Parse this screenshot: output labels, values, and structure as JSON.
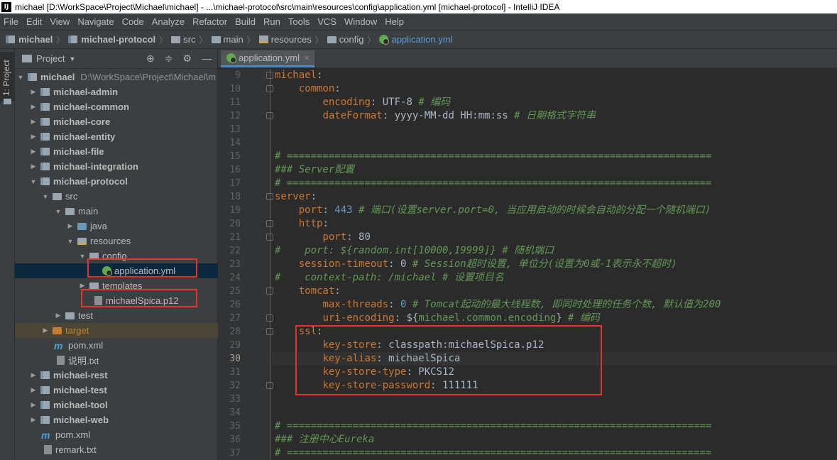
{
  "window": {
    "title": "michael [D:\\WorkSpace\\Project\\Michael\\michael] - ...\\michael-protocol\\src\\main\\resources\\config\\application.yml [michael-protocol] - IntelliJ IDEA",
    "app_icon": "IJ"
  },
  "menu": [
    "File",
    "Edit",
    "View",
    "Navigate",
    "Code",
    "Analyze",
    "Refactor",
    "Build",
    "Run",
    "Tools",
    "VCS",
    "Window",
    "Help"
  ],
  "breadcrumbs": [
    "michael",
    "michael-protocol",
    "src",
    "main",
    "resources",
    "config",
    "application.yml"
  ],
  "sidebar_tab": "1: Project",
  "project_panel": {
    "title": "Project",
    "root": {
      "name": "michael",
      "path": "D:\\WorkSpace\\Project\\Michael\\m"
    },
    "items": [
      {
        "label": "michael-admin"
      },
      {
        "label": "michael-common"
      },
      {
        "label": "michael-core"
      },
      {
        "label": "michael-entity"
      },
      {
        "label": "michael-file"
      },
      {
        "label": "michael-integration"
      },
      {
        "label": "michael-protocol"
      },
      {
        "label": "src"
      },
      {
        "label": "main"
      },
      {
        "label": "java"
      },
      {
        "label": "resources"
      },
      {
        "label": "config"
      },
      {
        "label": "application.yml"
      },
      {
        "label": "templates"
      },
      {
        "label": "michaelSpica.p12"
      },
      {
        "label": "test"
      },
      {
        "label": "target"
      },
      {
        "label": "pom.xml"
      },
      {
        "label": "说明.txt"
      },
      {
        "label": "michael-rest"
      },
      {
        "label": "michael-test"
      },
      {
        "label": "michael-tool"
      },
      {
        "label": "michael-web"
      },
      {
        "label": "pom.xml"
      },
      {
        "label": "remark.txt"
      }
    ]
  },
  "editor": {
    "tab_label": "application.yml",
    "close_glyph": "×",
    "current_line": 30,
    "lines": [
      {
        "n": "9",
        "t": [
          [
            "k",
            "michael"
          ],
          [
            "p",
            ":"
          ]
        ]
      },
      {
        "n": "10",
        "t": [
          [
            "p",
            "    "
          ],
          [
            "k",
            "common"
          ],
          [
            "p",
            ":"
          ]
        ]
      },
      {
        "n": "11",
        "t": [
          [
            "p",
            "        "
          ],
          [
            "k",
            "encoding"
          ],
          [
            "p",
            ": UTF-8 "
          ],
          [
            "c",
            "# 编码"
          ]
        ]
      },
      {
        "n": "12",
        "t": [
          [
            "p",
            "        "
          ],
          [
            "k",
            "dateFormat"
          ],
          [
            "p",
            ": yyyy-MM-dd HH:mm:ss "
          ],
          [
            "c",
            "# 日期格式字符串"
          ]
        ]
      },
      {
        "n": "13",
        "t": []
      },
      {
        "n": "14",
        "t": []
      },
      {
        "n": "15",
        "t": [
          [
            "c",
            "# ======================================================================="
          ]
        ]
      },
      {
        "n": "16",
        "t": [
          [
            "c",
            "### Server配置"
          ]
        ]
      },
      {
        "n": "17",
        "t": [
          [
            "c",
            "# ======================================================================="
          ]
        ]
      },
      {
        "n": "18",
        "t": [
          [
            "k",
            "server"
          ],
          [
            "p",
            ":"
          ]
        ]
      },
      {
        "n": "19",
        "t": [
          [
            "p",
            "    "
          ],
          [
            "k",
            "port"
          ],
          [
            "p",
            ": "
          ],
          [
            "n",
            "443"
          ],
          [
            "p",
            " "
          ],
          [
            "c",
            "# 端口(设置server.port=0, 当应用启动的时候会自动的分配一个随机端口)"
          ]
        ]
      },
      {
        "n": "20",
        "t": [
          [
            "p",
            "    "
          ],
          [
            "k",
            "http"
          ],
          [
            "p",
            ":"
          ]
        ]
      },
      {
        "n": "21",
        "t": [
          [
            "p",
            "        "
          ],
          [
            "k",
            "port"
          ],
          [
            "p",
            ": 80"
          ]
        ]
      },
      {
        "n": "22",
        "t": [
          [
            "c",
            "#    port: ${random.int[10000,19999]} # 随机端口"
          ]
        ]
      },
      {
        "n": "23",
        "t": [
          [
            "p",
            "    "
          ],
          [
            "k",
            "session-timeout"
          ],
          [
            "p",
            ": 0 "
          ],
          [
            "c",
            "# Session超时设置, 单位分(设置为0或-1表示永不超时)"
          ]
        ]
      },
      {
        "n": "24",
        "t": [
          [
            "c",
            "#    context-path: /michael # 设置项目名"
          ]
        ]
      },
      {
        "n": "25",
        "t": [
          [
            "p",
            "    "
          ],
          [
            "k",
            "tomcat"
          ],
          [
            "p",
            ":"
          ]
        ]
      },
      {
        "n": "26",
        "t": [
          [
            "p",
            "        "
          ],
          [
            "k",
            "max-threads"
          ],
          [
            "p",
            ": "
          ],
          [
            "n",
            "0"
          ],
          [
            "p",
            " "
          ],
          [
            "c",
            "# Tomcat起动的最大线程数, 即同时处理的任务个数, 默认值为200"
          ]
        ]
      },
      {
        "n": "27",
        "t": [
          [
            "p",
            "        "
          ],
          [
            "k",
            "uri-encoding"
          ],
          [
            "p",
            ": ${"
          ],
          [
            "cn",
            "michael.common.encoding"
          ],
          [
            "p",
            "} "
          ],
          [
            "c",
            "# 编码"
          ]
        ]
      },
      {
        "n": "28",
        "t": [
          [
            "p",
            "    "
          ],
          [
            "k",
            "ssl"
          ],
          [
            "p",
            ":"
          ]
        ]
      },
      {
        "n": "29",
        "t": [
          [
            "p",
            "        "
          ],
          [
            "k",
            "key-store"
          ],
          [
            "p",
            ": classpath:michaelSpica.p12"
          ]
        ]
      },
      {
        "n": "30",
        "t": [
          [
            "p",
            "        "
          ],
          [
            "k",
            "key-alias"
          ],
          [
            "p",
            ": michaelSpica"
          ]
        ]
      },
      {
        "n": "31",
        "t": [
          [
            "p",
            "        "
          ],
          [
            "k",
            "key-store-type"
          ],
          [
            "p",
            ": PKCS12"
          ]
        ]
      },
      {
        "n": "32",
        "t": [
          [
            "p",
            "        "
          ],
          [
            "k",
            "key-store-password"
          ],
          [
            "p",
            ": 111111"
          ]
        ]
      },
      {
        "n": "33",
        "t": []
      },
      {
        "n": "34",
        "t": []
      },
      {
        "n": "35",
        "t": [
          [
            "c",
            "# ======================================================================="
          ]
        ]
      },
      {
        "n": "36",
        "t": [
          [
            "c",
            "### 注册中心Eureka"
          ]
        ]
      },
      {
        "n": "37",
        "t": [
          [
            "c",
            "# ======================================================================="
          ]
        ]
      }
    ]
  },
  "colors": {
    "keyword": "#cc7832",
    "comment": "#629755",
    "number": "#6897bb",
    "highlight_box": "#e5322d"
  }
}
